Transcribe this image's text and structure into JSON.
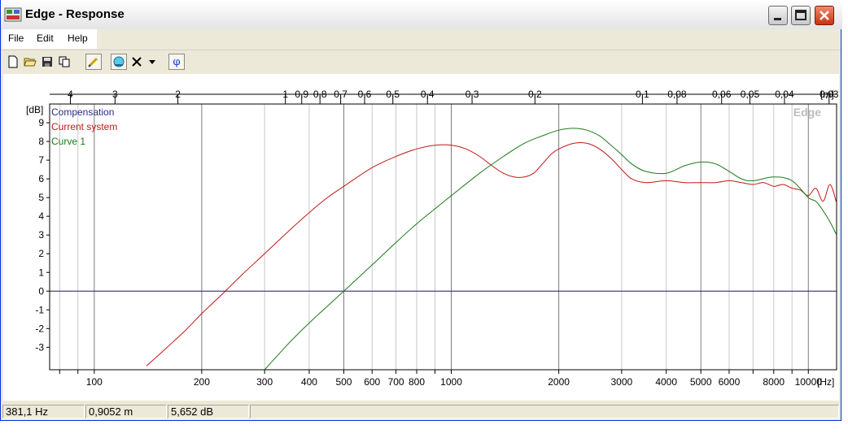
{
  "window": {
    "title": "Edge - Response"
  },
  "menu": {
    "items": [
      "File",
      "Edit",
      "Help"
    ]
  },
  "toolbar": {
    "tools": [
      "new-file-icon",
      "open-folder-icon",
      "save-icon",
      "copy-icon",
      "pen-icon",
      "cursor-icon",
      "delete-icon",
      "dropdown-arrow-icon",
      "phase-icon"
    ],
    "phase_label": "φ"
  },
  "watermark": "Edge",
  "legend": [
    {
      "name": "Compensation",
      "color": "#2a2a8a"
    },
    {
      "name": "Current system",
      "color": "#c01818"
    },
    {
      "name": "Curve 1",
      "color": "#1a7a1a"
    }
  ],
  "chart_data": {
    "type": "line",
    "title": "",
    "xlabel": "[Hz]",
    "ylabel": "[dB]",
    "top_axis_label": "[m]",
    "x_scale": "log",
    "xlim": [
      75,
      12000
    ],
    "ylim": [
      -4.2,
      10
    ],
    "grid": true,
    "x_ticks": [
      {
        "v": 100,
        "label": "100"
      },
      {
        "v": 200,
        "label": "200"
      },
      {
        "v": 300,
        "label": "300"
      },
      {
        "v": 400,
        "label": "400"
      },
      {
        "v": 500,
        "label": "500"
      },
      {
        "v": 600,
        "label": "600"
      },
      {
        "v": 700,
        "label": "700"
      },
      {
        "v": 800,
        "label": "800"
      },
      {
        "v": 1000,
        "label": "1000"
      },
      {
        "v": 2000,
        "label": "2000"
      },
      {
        "v": 3000,
        "label": "3000"
      },
      {
        "v": 4000,
        "label": "4000"
      },
      {
        "v": 5000,
        "label": "5000"
      },
      {
        "v": 6000,
        "label": "6000"
      },
      {
        "v": 8000,
        "label": "8000"
      },
      {
        "v": 10000,
        "label": "10000"
      }
    ],
    "top_ticks": [
      {
        "v": 4,
        "label": "4"
      },
      {
        "v": 3,
        "label": "3"
      },
      {
        "v": 2,
        "label": "2"
      },
      {
        "v": 1,
        "label": "1"
      },
      {
        "v": 0.9,
        "label": "0,9"
      },
      {
        "v": 0.8,
        "label": "0,8"
      },
      {
        "v": 0.7,
        "label": "0,7"
      },
      {
        "v": 0.6,
        "label": "0,6"
      },
      {
        "v": 0.5,
        "label": "0,5"
      },
      {
        "v": 0.4,
        "label": "0,4"
      },
      {
        "v": 0.3,
        "label": "0,3"
      },
      {
        "v": 0.2,
        "label": "0,2"
      },
      {
        "v": 0.1,
        "label": "0,1"
      },
      {
        "v": 0.08,
        "label": "0,08"
      },
      {
        "v": 0.06,
        "label": "0,06"
      },
      {
        "v": 0.05,
        "label": "0,05"
      },
      {
        "v": 0.04,
        "label": "0,04"
      },
      {
        "v": 0.03,
        "label": "0,03"
      },
      {
        "v": 0.02,
        "label": "0,02"
      }
    ],
    "y_ticks": [
      9,
      8,
      7,
      6,
      5,
      4,
      3,
      2,
      1,
      0,
      -1,
      -2,
      -3
    ],
    "series": [
      {
        "name": "Current system",
        "color": "#c01818",
        "x": [
          140,
          160,
          180,
          200,
          230,
          260,
          300,
          350,
          400,
          450,
          500,
          600,
          700,
          800,
          900,
          1000,
          1100,
          1200,
          1300,
          1400,
          1500,
          1600,
          1700,
          1800,
          1900,
          2000,
          2200,
          2400,
          2600,
          2800,
          3000,
          3200,
          3500,
          4000,
          4500,
          5000,
          5500,
          6000,
          6500,
          7000,
          7500,
          8000,
          8500,
          9000,
          9500,
          10000,
          10500,
          11000,
          11500,
          12000
        ],
        "y": [
          -4.0,
          -3.0,
          -2.1,
          -1.2,
          -0.1,
          0.9,
          2.0,
          3.2,
          4.2,
          5.0,
          5.6,
          6.6,
          7.2,
          7.6,
          7.8,
          7.8,
          7.6,
          7.2,
          6.7,
          6.3,
          6.1,
          6.1,
          6.3,
          6.8,
          7.3,
          7.6,
          7.9,
          7.9,
          7.6,
          7.1,
          6.5,
          6.0,
          5.8,
          5.9,
          5.8,
          5.8,
          5.8,
          5.9,
          5.8,
          5.7,
          5.8,
          5.6,
          5.7,
          5.5,
          5.4,
          5.1,
          5.5,
          4.8,
          5.7,
          4.7
        ]
      },
      {
        "name": "Curve 1",
        "color": "#1a7a1a",
        "x": [
          300,
          350,
          400,
          450,
          500,
          600,
          700,
          800,
          900,
          1000,
          1200,
          1400,
          1600,
          1800,
          2000,
          2200,
          2400,
          2600,
          2800,
          3000,
          3200,
          3500,
          4000,
          4500,
          5000,
          5500,
          6000,
          6500,
          7000,
          8000,
          9000,
          10000,
          10500,
          11000,
          11500,
          12000
        ],
        "y": [
          -4.2,
          -2.8,
          -1.7,
          -0.8,
          0.0,
          1.4,
          2.6,
          3.6,
          4.4,
          5.1,
          6.3,
          7.2,
          7.9,
          8.3,
          8.6,
          8.7,
          8.6,
          8.3,
          7.8,
          7.3,
          6.8,
          6.4,
          6.3,
          6.7,
          6.9,
          6.8,
          6.4,
          6.0,
          5.9,
          6.1,
          5.9,
          5.0,
          4.8,
          4.3,
          3.7,
          3.0
        ]
      }
    ]
  },
  "status": {
    "frequency": "381,1 Hz",
    "distance": "0,9052 m",
    "level": "5,652 dB"
  }
}
